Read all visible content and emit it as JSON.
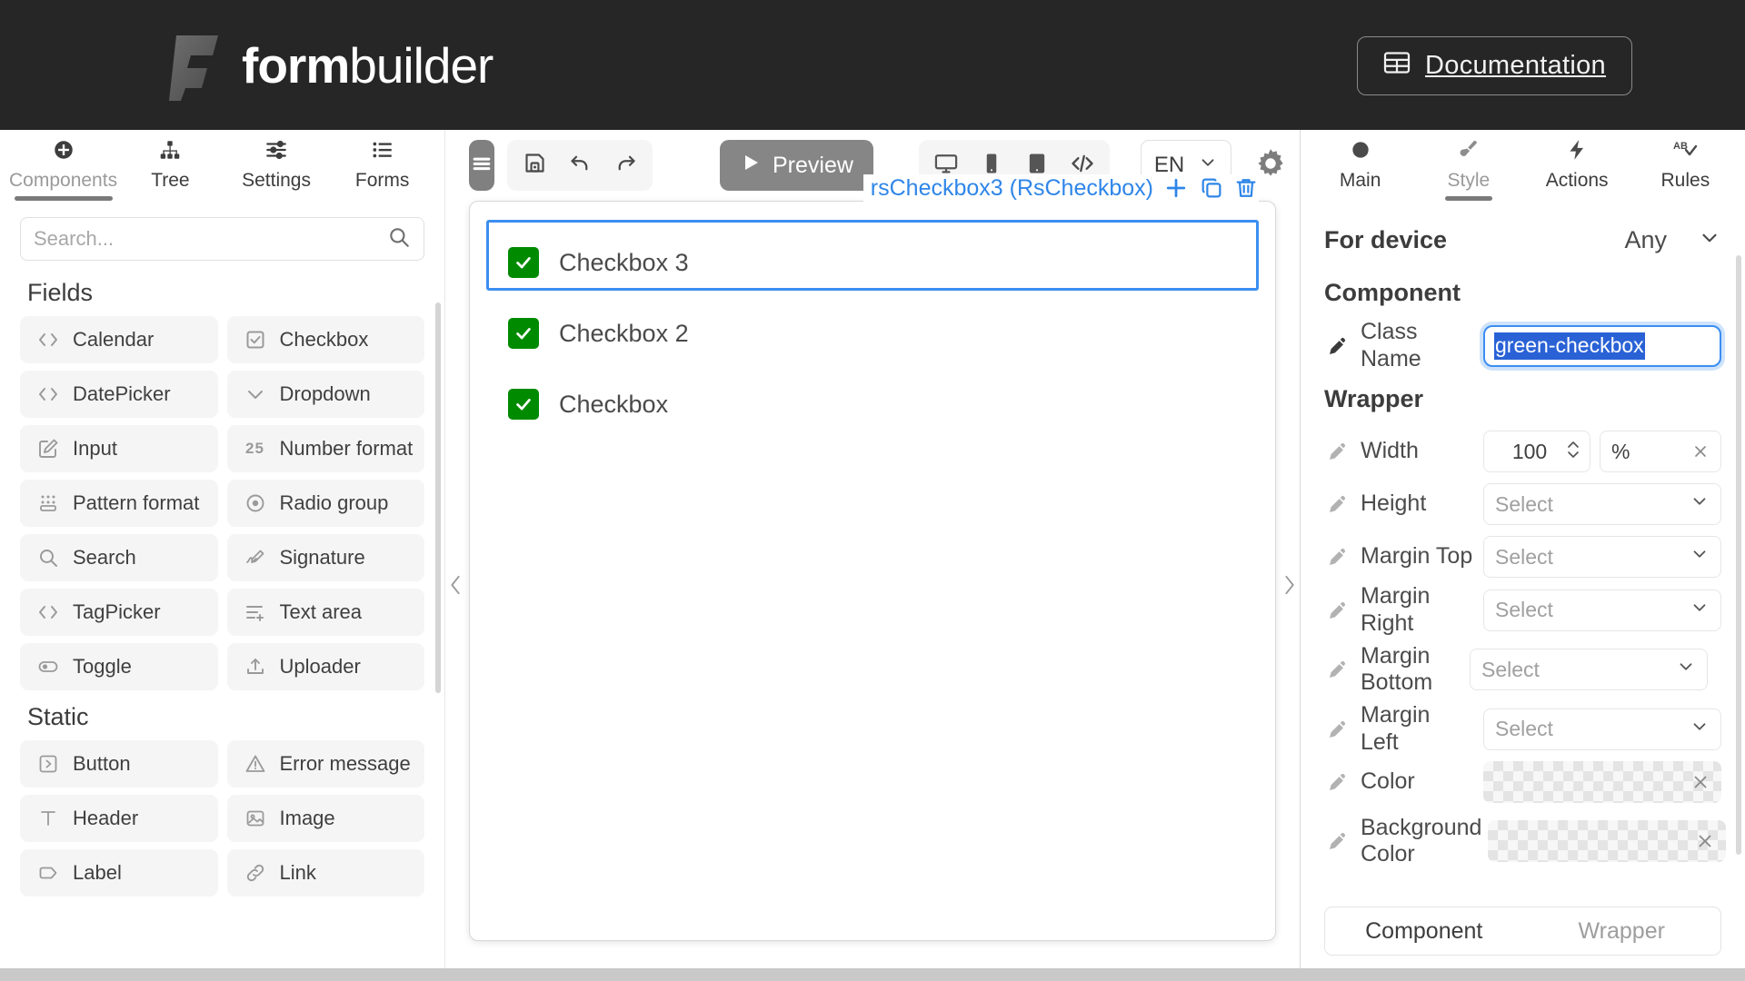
{
  "topbar": {
    "brand_bold": "form",
    "brand_light": "builder",
    "documentation_label": "Documentation",
    "documentation_icon": "table-icon",
    "background": "#262626"
  },
  "left_panel": {
    "nav": [
      {
        "label": "Components",
        "icon": "plus-circle-icon",
        "active": true
      },
      {
        "label": "Tree",
        "icon": "sitemap-icon",
        "active": false
      },
      {
        "label": "Settings",
        "icon": "sliders-icon",
        "active": false
      },
      {
        "label": "Forms",
        "icon": "list-icon",
        "active": false
      }
    ],
    "search": {
      "placeholder": "Search...",
      "value": "",
      "icon": "search-icon"
    },
    "sections": [
      {
        "title": "Fields",
        "items": [
          {
            "label": "Calendar",
            "icon": "code-icon"
          },
          {
            "label": "Checkbox",
            "icon": "checkbox-icon"
          },
          {
            "label": "DatePicker",
            "icon": "code-icon"
          },
          {
            "label": "Dropdown",
            "icon": "chevron-down-icon"
          },
          {
            "label": "Input",
            "icon": "edit-square-icon"
          },
          {
            "label": "Number format",
            "icon": "number-25-icon"
          },
          {
            "label": "Pattern format",
            "icon": "dots-grid-icon"
          },
          {
            "label": "Radio group",
            "icon": "radio-icon"
          },
          {
            "label": "Search",
            "icon": "search-icon"
          },
          {
            "label": "Signature",
            "icon": "signature-pen-icon"
          },
          {
            "label": "TagPicker",
            "icon": "code-icon"
          },
          {
            "label": "Text area",
            "icon": "text-lines-plus-icon"
          },
          {
            "label": "Toggle",
            "icon": "toggle-icon"
          },
          {
            "label": "Uploader",
            "icon": "upload-icon"
          }
        ]
      },
      {
        "title": "Static",
        "items": [
          {
            "label": "Button",
            "icon": "button-play-icon"
          },
          {
            "label": "Error message",
            "icon": "alert-triangle-icon"
          },
          {
            "label": "Header",
            "icon": "text-t-icon"
          },
          {
            "label": "Image",
            "icon": "image-icon"
          },
          {
            "label": "Label",
            "icon": "tag-icon"
          },
          {
            "label": "Link",
            "icon": "link-icon"
          }
        ]
      }
    ]
  },
  "toolbar": {
    "burger_icon": "menu-icon",
    "save_icon": "save-icon",
    "undo_icon": "undo-icon",
    "redo_icon": "redo-icon",
    "preview_label": "Preview",
    "preview_icon": "play-icon",
    "devices": [
      {
        "name": "desktop-icon",
        "active": false
      },
      {
        "name": "mobile-icon",
        "active": false
      },
      {
        "name": "tablet-icon",
        "active": false
      },
      {
        "name": "code-brackets-icon",
        "active": false
      }
    ],
    "language": {
      "value": "EN",
      "icon": "chevron-down-icon"
    },
    "settings_icon": "gear-icon"
  },
  "canvas": {
    "selection": {
      "label": "rsCheckbox3 (RsCheckbox)",
      "color": "#2f86e8",
      "actions": [
        {
          "name": "add-icon",
          "glyph": "+"
        },
        {
          "name": "duplicate-icon",
          "glyph": "copy"
        },
        {
          "name": "delete-icon",
          "glyph": "trash"
        }
      ]
    },
    "collapse_left_icon": "chevron-left-icon",
    "collapse_right_icon": "chevron-right-icon",
    "checkbox_color": "#008a00",
    "fields": [
      {
        "label": "Checkbox 3",
        "checked": true,
        "selected": true
      },
      {
        "label": "Checkbox 2",
        "checked": true,
        "selected": false
      },
      {
        "label": "Checkbox",
        "checked": true,
        "selected": false
      }
    ]
  },
  "right_panel": {
    "nav": [
      {
        "label": "Main",
        "icon": "circle-icon",
        "active": false
      },
      {
        "label": "Style",
        "icon": "paint-brush-icon",
        "active": true
      },
      {
        "label": "Actions",
        "icon": "lightning-icon",
        "active": false
      },
      {
        "label": "Rules",
        "icon": "ab-check-icon",
        "active": false
      }
    ],
    "for_device": {
      "label": "For device",
      "value": "Any",
      "icon": "chevron-down-icon"
    },
    "component_heading": "Component",
    "wrapper_heading": "Wrapper",
    "class_name": {
      "label": "Class Name",
      "value": "green-checkbox",
      "selected": true,
      "icon": "pen-icon"
    },
    "rows": [
      {
        "label": "Width",
        "type": "number_unit",
        "value": "100",
        "unit": "%",
        "icon": "pen-icon",
        "clear_icon": "close-icon"
      },
      {
        "label": "Height",
        "type": "select",
        "placeholder": "Select",
        "icon": "pen-icon"
      },
      {
        "label": "Margin Top",
        "type": "select",
        "placeholder": "Select",
        "icon": "pen-icon"
      },
      {
        "label": "Margin Right",
        "type": "select",
        "placeholder": "Select",
        "icon": "pen-icon"
      },
      {
        "label": "Margin Bottom",
        "type": "select",
        "placeholder": "Select",
        "icon": "pen-icon"
      },
      {
        "label": "Margin Left",
        "type": "select",
        "placeholder": "Select",
        "icon": "pen-icon"
      },
      {
        "label": "Color",
        "type": "color",
        "value": "",
        "icon": "pen-icon",
        "clear_icon": "close-icon"
      },
      {
        "label": "Background Color",
        "type": "color",
        "value": "",
        "icon": "pen-icon",
        "clear_icon": "close-icon"
      }
    ],
    "tabs": [
      {
        "label": "Component",
        "active": true
      },
      {
        "label": "Wrapper",
        "active": false
      }
    ]
  }
}
